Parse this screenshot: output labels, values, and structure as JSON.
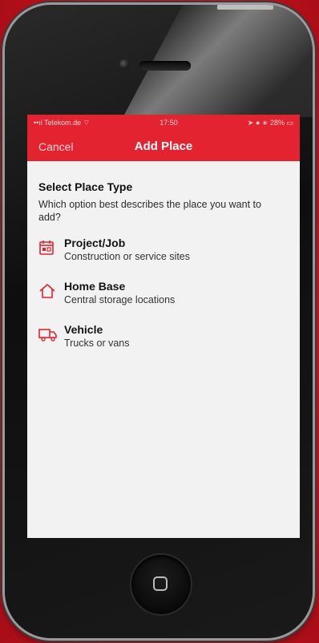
{
  "colors": {
    "accent": "#e3232f",
    "background": "#d91d2c",
    "screen_bg": "#f2f2f2",
    "icon": "#e3232f"
  },
  "status_bar": {
    "carrier": "Telekom.de",
    "time": "17:50",
    "battery": "28%"
  },
  "nav": {
    "cancel_label": "Cancel",
    "title": "Add Place"
  },
  "content": {
    "title": "Select Place Type",
    "subtitle": "Which option best describes the place you want to add?",
    "options": [
      {
        "icon": "calendar-icon",
        "title": "Project/Job",
        "description": "Construction or service sites"
      },
      {
        "icon": "home-icon",
        "title": "Home Base",
        "description": "Central storage locations"
      },
      {
        "icon": "truck-icon",
        "title": "Vehicle",
        "description": "Trucks or vans"
      }
    ]
  }
}
